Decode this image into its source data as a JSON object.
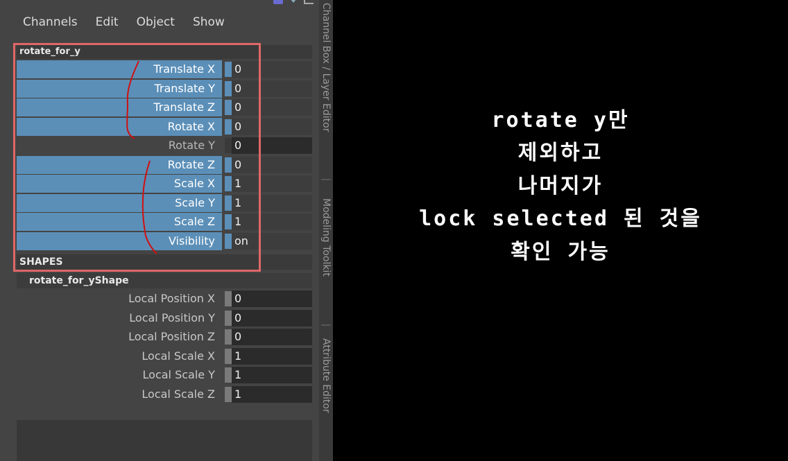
{
  "menu": [
    "Channels",
    "Edit",
    "Object",
    "Show"
  ],
  "node": {
    "name": "rotate_for_y",
    "channels": [
      {
        "label": "Translate X",
        "value": "0",
        "locked": true
      },
      {
        "label": "Translate Y",
        "value": "0",
        "locked": true
      },
      {
        "label": "Translate Z",
        "value": "0",
        "locked": true
      },
      {
        "label": "Rotate X",
        "value": "0",
        "locked": true
      },
      {
        "label": "Rotate Y",
        "value": "0",
        "locked": false
      },
      {
        "label": "Rotate Z",
        "value": "0",
        "locked": true
      },
      {
        "label": "Scale X",
        "value": "1",
        "locked": true
      },
      {
        "label": "Scale Y",
        "value": "1",
        "locked": true
      },
      {
        "label": "Scale Z",
        "value": "1",
        "locked": true
      },
      {
        "label": "Visibility",
        "value": "on",
        "locked": true
      }
    ]
  },
  "shapes": {
    "header": "SHAPES",
    "name": "rotate_for_yShape",
    "channels": [
      {
        "label": "Local Position X",
        "value": "0"
      },
      {
        "label": "Local Position Y",
        "value": "0"
      },
      {
        "label": "Local Position Z",
        "value": "0"
      },
      {
        "label": "Local Scale X",
        "value": "1"
      },
      {
        "label": "Local Scale Y",
        "value": "1"
      },
      {
        "label": "Local Scale Z",
        "value": "1"
      }
    ]
  },
  "side_tabs": [
    "Channel Box / Layer Editor",
    "Modeling Toolkit",
    "Attribute Editor"
  ],
  "annotation": [
    "rotate y만",
    "제외하고",
    "나머지가",
    "lock selected 된 것을",
    "확인 가능"
  ],
  "colors": {
    "locked_channel": "#5b8fb8",
    "highlight_border": "#e06767",
    "scribble": "#d01010"
  }
}
